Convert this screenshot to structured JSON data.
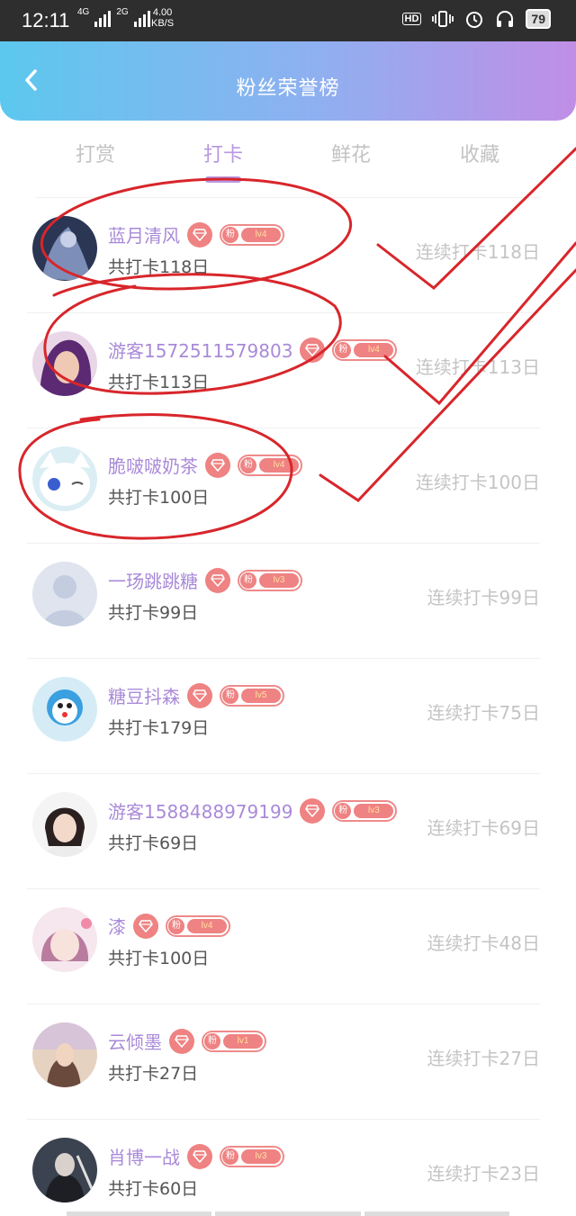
{
  "status_bar": {
    "time": "12:11",
    "network1": "4G",
    "network2": "2G",
    "speed_value": "4.00",
    "speed_unit": "KB/S",
    "hd": "HD",
    "battery": "79"
  },
  "header": {
    "title": "粉丝荣誉榜",
    "back_icon": "chevron-left-icon"
  },
  "tabs": [
    {
      "label": "打赏",
      "active": false
    },
    {
      "label": "打卡",
      "active": true
    },
    {
      "label": "鲜花",
      "active": false
    },
    {
      "label": "收藏",
      "active": false
    }
  ],
  "fan_badge_label": "粉",
  "rows": [
    {
      "name": "蓝月清风",
      "level": "lv4",
      "total": "共打卡118日",
      "streak": "连续打卡118日"
    },
    {
      "name": "游客1572511579803",
      "level": "lv4",
      "total": "共打卡113日",
      "streak": "连续打卡113日"
    },
    {
      "name": "脆啵啵奶茶",
      "level": "lv4",
      "total": "共打卡100日",
      "streak": "连续打卡100日"
    },
    {
      "name": "一玚跳跳糖",
      "level": "lv3",
      "total": "共打卡99日",
      "streak": "连续打卡99日"
    },
    {
      "name": "糖豆抖森",
      "level": "lv5",
      "total": "共打卡179日",
      "streak": "连续打卡75日"
    },
    {
      "name": "游客1588488979199",
      "level": "lv3",
      "total": "共打卡69日",
      "streak": "连续打卡69日"
    },
    {
      "name": "漆",
      "level": "lv4",
      "total": "共打卡100日",
      "streak": "连续打卡48日"
    },
    {
      "name": "云倾墨",
      "level": "lv1",
      "total": "共打卡27日",
      "streak": "连续打卡27日"
    },
    {
      "name": "肖博一战",
      "level": "lv3",
      "total": "共打卡60日",
      "streak": "连续打卡23日"
    }
  ],
  "colors": {
    "accent_purple": "#b898e0",
    "name_purple": "#a98ad8",
    "badge_red": "#ef8282",
    "annotation_red": "#d8262b"
  }
}
